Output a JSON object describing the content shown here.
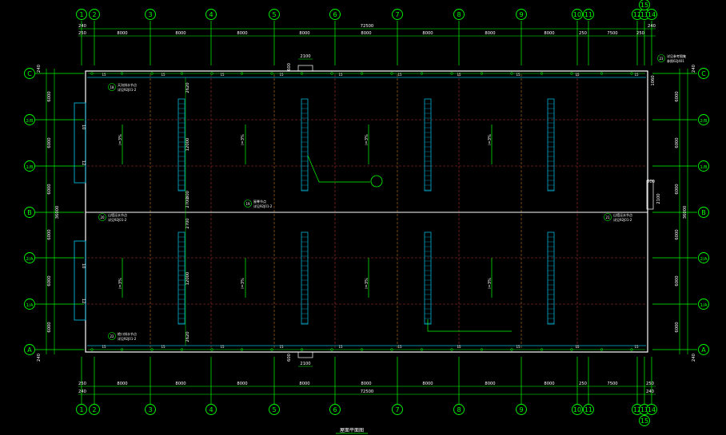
{
  "drawing": {
    "title": "屋面平面图",
    "colors": {
      "background": "#000000",
      "grid_lines": "#00ff00",
      "axis_bubbles": "#00ff00",
      "outline": "#ffffff",
      "cyan": "#00b4d8",
      "dash_red": "#b03030",
      "dash_orange": "#c07820",
      "text_white": "#ffffff"
    }
  },
  "axes_x": [
    "1",
    "2",
    "3",
    "4",
    "5",
    "6",
    "7",
    "8",
    "9",
    "10",
    "11",
    "12",
    "13",
    "14"
  ],
  "axes_x_top_extra": "15",
  "axes_y": [
    "C",
    "2/B",
    "1/B",
    "B",
    "2/A",
    "1/A",
    "A"
  ],
  "dims_top": {
    "overall": "72500",
    "offsets": [
      "240",
      "250",
      "250",
      "240"
    ],
    "bays": [
      "8000",
      "8000",
      "8000",
      "8000",
      "8000",
      "8000",
      "8000",
      "8000",
      "250",
      "7500",
      "250"
    ]
  },
  "dims_bottom": {
    "overall": "72500",
    "offsets": [
      "250",
      "240",
      "250",
      "240"
    ],
    "bays": [
      "8000",
      "8000",
      "8000",
      "8000",
      "8000",
      "8000",
      "8000",
      "8000",
      "250",
      "7500"
    ]
  },
  "dims_side": {
    "overall": "36000",
    "spans": [
      "6000",
      "6000",
      "6000",
      "6000",
      "6000",
      "6000"
    ],
    "edge": "240"
  },
  "inner_dims": {
    "skylight_width": "2100",
    "gutter_offset": "600",
    "vertical": [
      "2620",
      "12000",
      "800",
      "2700",
      "2700",
      "12000",
      "2620"
    ],
    "right_side": [
      "1060",
      "2100",
      "500"
    ]
  },
  "slopes": [
    "i=3%",
    "i=3%",
    "i=3%",
    "i=3%",
    "i=3%",
    "i=3%",
    "i=3%",
    "i=3%"
  ],
  "side_labels": [
    "10",
    "12",
    "10",
    "12"
  ],
  "callouts": [
    {
      "title": "天沟排水节点",
      "ref": "详见92J01-2",
      "num": "18"
    },
    {
      "title": "屋脊节点",
      "ref": "详见92J01-2",
      "num": "19"
    },
    {
      "title": "山墙泛水节点",
      "ref": "详见92J01-2",
      "num": "20"
    },
    {
      "title": "山墙泛水节点",
      "ref": "详见92J01-2",
      "num": "21"
    },
    {
      "title": "檐口排水节点",
      "ref": "详见92J01-2",
      "num": "22"
    },
    {
      "title": "详见参考图集",
      "ref": "参照02J401",
      "num": "23"
    }
  ],
  "gutter_labels": [
    "15",
    "15",
    "15",
    "15",
    "15",
    "15",
    "15",
    "15",
    "15",
    "15",
    "15",
    "15",
    "15",
    "15",
    "15",
    "15",
    "15",
    "15",
    "15",
    "15"
  ]
}
